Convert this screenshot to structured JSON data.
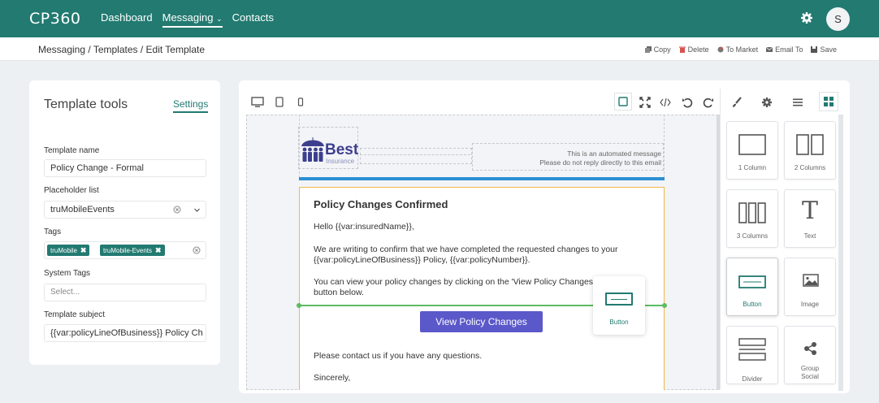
{
  "app": {
    "brand": "CP360",
    "nav": [
      "Dashboard",
      "Messaging",
      "Contacts"
    ],
    "nav_active": "Messaging",
    "avatar_initial": "S",
    "accent_color": "#227a71"
  },
  "breadcrumb": "Messaging / Templates / Edit Template",
  "actions": {
    "copy": "Copy",
    "delete": "Delete",
    "to_market": "To Market",
    "email_to": "Email To",
    "save": "Save"
  },
  "left_panel": {
    "title": "Template tools",
    "settings_tab": "Settings",
    "template_name_label": "Template name",
    "template_name_value": "Policy Change - Formal",
    "placeholder_list_label": "Placeholder list",
    "placeholder_list_value": "truMobileEvents",
    "tags_label": "Tags",
    "tags": [
      "truMobile",
      "truMobile-Events"
    ],
    "system_tags_label": "System Tags",
    "system_tags_placeholder": "Select...",
    "template_subject_label": "Template subject",
    "template_subject_value": "{{var:policyLineOfBusiness}} Policy Ch"
  },
  "toolbar": {
    "icons": [
      "desktop-icon",
      "tablet-icon",
      "mobile-icon",
      "outline-icon",
      "fullscreen-icon",
      "code-icon",
      "undo-icon",
      "redo-icon",
      "brush-icon",
      "gear-icon",
      "layers-icon",
      "blocks-icon"
    ]
  },
  "email": {
    "logo_text": "Best",
    "logo_sub": "Insurance",
    "auto_msg_line1": "This is an automated message",
    "auto_msg_line2": "Please do not reply directly to this email",
    "heading": "Policy Changes Confirmed",
    "greeting": "Hello {{var:insuredName}},",
    "para1": "We are writing to confirm that we have completed the requested changes to your {{var:policyLineOfBusiness}} Policy, {{var:policyNumber}}.",
    "para2": "You can view your policy changes by clicking on the 'View Policy Changes' button below.",
    "button_label": "View Policy Changes",
    "contact": "Please contact us if you have any questions.",
    "sign_off": "Sincerely,"
  },
  "drag_ghost": {
    "label": "Button"
  },
  "blocks": [
    {
      "label": "1 Column"
    },
    {
      "label": "2 Columns"
    },
    {
      "label": "3 Columns"
    },
    {
      "label": "Text"
    },
    {
      "label": "Button"
    },
    {
      "label": "Image"
    },
    {
      "label": "Divider"
    },
    {
      "label": "Group Social"
    }
  ]
}
